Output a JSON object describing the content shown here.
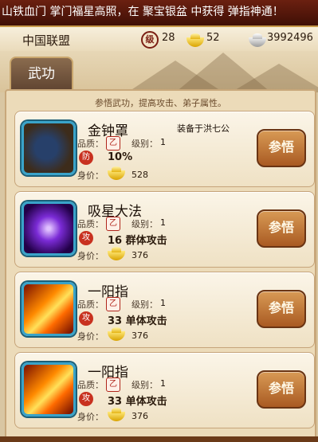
{
  "ticker": {
    "text": "山铁血门 掌门福星高照，在 聚宝银盆 中获得 弹指神通！"
  },
  "topbar": {
    "alliance": "中国联盟",
    "level_icon": "级",
    "level": "28",
    "gold": "52",
    "silver": "3992496"
  },
  "tab": {
    "label": "武功"
  },
  "panel": {
    "hint": "参悟武功，提高攻击、弟子属性。"
  },
  "labels": {
    "quality": "品质：",
    "level": "级别：",
    "price": "身价：",
    "quality_seal": "乙",
    "action": "参悟"
  },
  "skills": [
    {
      "name": "金钟罩",
      "icon": "bell-shield-icon",
      "level": "1",
      "equip": "装备于洪七公",
      "effect_icon": "防",
      "effect": "10%",
      "price": "528"
    },
    {
      "name": "吸星大法",
      "icon": "purple-star-icon",
      "level": "1",
      "equip": "",
      "effect_icon": "攻",
      "effect": "16 群体攻击",
      "price": "376"
    },
    {
      "name": "一阳指",
      "icon": "finger-fire-icon",
      "level": "1",
      "equip": "",
      "effect_icon": "攻",
      "effect": "33 单体攻击",
      "price": "376"
    },
    {
      "name": "一阳指",
      "icon": "finger-fire-icon",
      "level": "1",
      "equip": "",
      "effect_icon": "攻",
      "effect": "33 单体攻击",
      "price": "376"
    }
  ]
}
